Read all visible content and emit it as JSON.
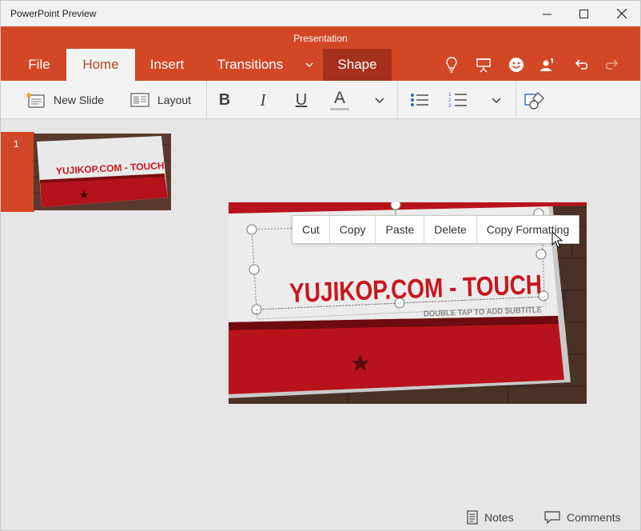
{
  "window": {
    "title": "PowerPoint Preview"
  },
  "ribbon": {
    "document_title": "Presentation",
    "tabs": [
      {
        "label": "File"
      },
      {
        "label": "Home"
      },
      {
        "label": "Insert"
      },
      {
        "label": "Transitions"
      },
      {
        "label": "Shape"
      }
    ],
    "active_tab": "Home",
    "icons": [
      "lightbulb-icon",
      "present-icon",
      "smiley-icon",
      "share-person-icon",
      "undo-icon",
      "redo-icon"
    ]
  },
  "toolbar": {
    "new_slide_label": "New Slide",
    "layout_label": "Layout",
    "bold": "B",
    "italic": "I",
    "underline": "U",
    "font_color": "A"
  },
  "thumbnails": {
    "number": "1"
  },
  "slide": {
    "title": "YUJIKOP.COM - TOUCH",
    "subtitle_placeholder": "DOUBLE TAP TO ADD SUBTITLE"
  },
  "context_menu": {
    "items": [
      "Cut",
      "Copy",
      "Paste",
      "Delete",
      "Copy Formatting"
    ]
  },
  "status_bar": {
    "notes_label": "Notes",
    "comments_label": "Comments"
  },
  "colors": {
    "accent": "#d24726",
    "shape_tab": "#a5301c",
    "slide_red": "#c8161d"
  }
}
